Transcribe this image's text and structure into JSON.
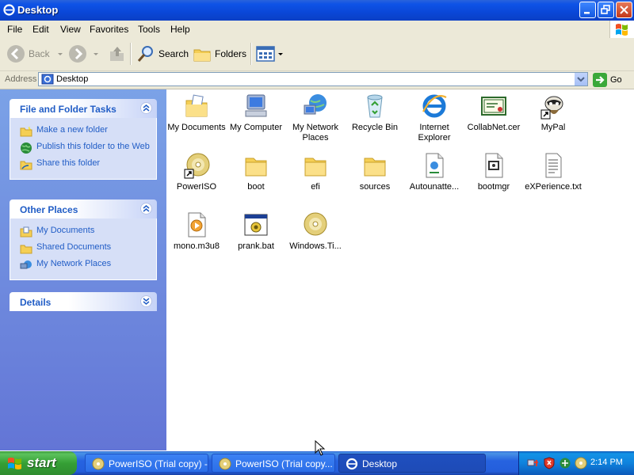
{
  "window": {
    "title": "Desktop"
  },
  "menu": [
    "File",
    "Edit",
    "View",
    "Favorites",
    "Tools",
    "Help"
  ],
  "toolbar": {
    "back": "Back",
    "search": "Search",
    "folders": "Folders"
  },
  "address": {
    "label": "Address",
    "value": "Desktop",
    "go": "Go"
  },
  "task_pane": {
    "file_tasks": {
      "title": "File and Folder Tasks",
      "links": [
        "Make a new folder",
        "Publish this folder to the Web",
        "Share this folder"
      ]
    },
    "other_places": {
      "title": "Other Places",
      "links": [
        "My Documents",
        "Shared Documents",
        "My Network Places"
      ]
    },
    "details": {
      "title": "Details"
    }
  },
  "files": [
    {
      "name": "My Documents",
      "icon": "my-documents-icon"
    },
    {
      "name": "My Computer",
      "icon": "my-computer-icon"
    },
    {
      "name": "My Network Places",
      "icon": "network-places-icon"
    },
    {
      "name": "Recycle Bin",
      "icon": "recycle-bin-icon"
    },
    {
      "name": "Internet Explorer",
      "icon": "internet-explorer-icon"
    },
    {
      "name": "CollabNet.cer",
      "icon": "certificate-icon"
    },
    {
      "name": "MyPal",
      "icon": "mypal-icon"
    },
    {
      "name": "PowerISO",
      "icon": "cd-shortcut-icon"
    },
    {
      "name": "boot",
      "icon": "folder-icon"
    },
    {
      "name": "efi",
      "icon": "folder-icon"
    },
    {
      "name": "sources",
      "icon": "folder-icon"
    },
    {
      "name": "Autounatte...",
      "icon": "xml-file-icon"
    },
    {
      "name": "bootmgr",
      "icon": "system-file-icon"
    },
    {
      "name": "eXPerience.txt",
      "icon": "text-file-icon"
    },
    {
      "name": "mono.m3u8",
      "icon": "playlist-file-icon"
    },
    {
      "name": "prank.bat",
      "icon": "batch-file-icon"
    },
    {
      "name": "Windows.Ti...",
      "icon": "disc-image-icon"
    }
  ],
  "taskbar": {
    "start": "start",
    "tasks": [
      "PowerISO (Trial copy) -",
      "PowerISO (Trial copy...",
      "Desktop"
    ],
    "clock": "2:14 PM"
  },
  "colors": {
    "title_bar": "#0a47d8",
    "task_pane": "#6f8fe0",
    "link": "#215dc6",
    "start": "#35a035"
  }
}
